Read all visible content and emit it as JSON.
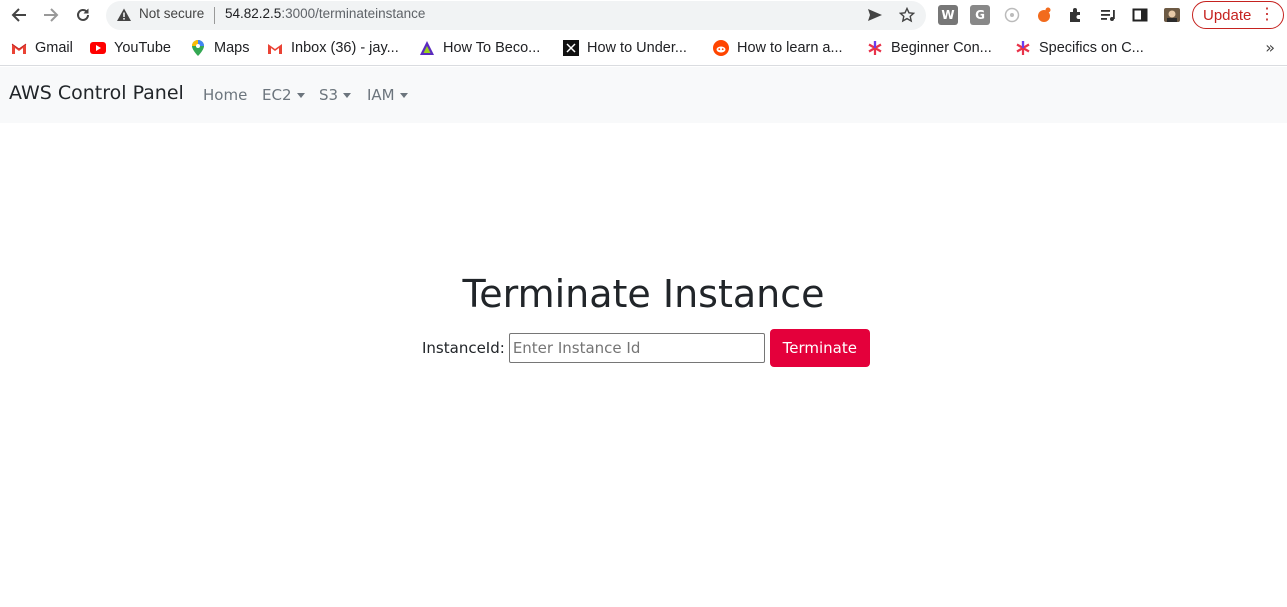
{
  "browser": {
    "security_label": "Not secure",
    "url_host": "54.82.2.5",
    "url_path": ":3000/terminateinstance",
    "update_label": "Update",
    "extensions": [
      {
        "name": "w-extension",
        "glyph": "W"
      },
      {
        "name": "g-extension",
        "glyph": "G"
      }
    ]
  },
  "bookmarks": [
    {
      "label": "Gmail",
      "icon": "gmail-icon"
    },
    {
      "label": "YouTube",
      "icon": "youtube-icon"
    },
    {
      "label": "Maps",
      "icon": "maps-icon"
    },
    {
      "label": "Inbox (36) - jay...",
      "icon": "gmail-icon"
    },
    {
      "label": "How To Beco...",
      "icon": "triangle-icon"
    },
    {
      "label": "How to Under...",
      "icon": "dark-square-icon"
    },
    {
      "label": "How to learn a...",
      "icon": "reddit-icon"
    },
    {
      "label": "Beginner Con...",
      "icon": "asterisk-icon"
    },
    {
      "label": "Specifics on C...",
      "icon": "asterisk-icon"
    }
  ],
  "navbar": {
    "brand": "AWS Control Panel",
    "links": [
      {
        "label": "Home",
        "dropdown": false
      },
      {
        "label": "EC2",
        "dropdown": true
      },
      {
        "label": "S3",
        "dropdown": true
      },
      {
        "label": "IAM",
        "dropdown": true
      }
    ]
  },
  "main": {
    "title": "Terminate Instance",
    "instance_label": "InstanceId:",
    "instance_placeholder": "Enter Instance Id",
    "instance_value": "",
    "submit_label": "Terminate"
  },
  "colors": {
    "accent": "#e4003b",
    "navbar_bg": "#f8f9fa",
    "update": "#c5221f"
  }
}
